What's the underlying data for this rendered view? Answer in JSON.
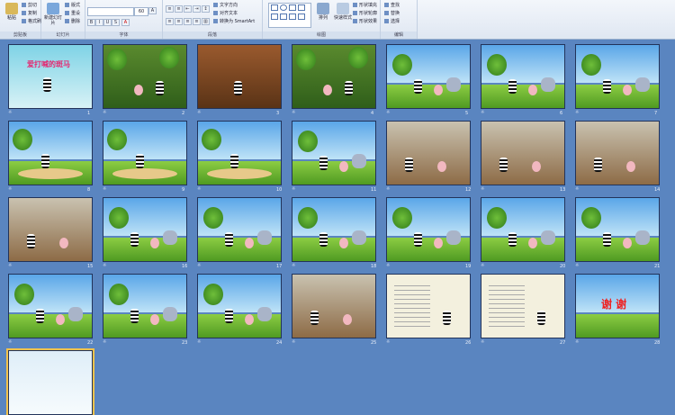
{
  "ribbon": {
    "groups": [
      {
        "label": "剪贴板"
      },
      {
        "label": "幻灯片"
      },
      {
        "label": "字体"
      },
      {
        "label": "段落"
      },
      {
        "label": "绘图"
      },
      {
        "label": "编辑"
      }
    ],
    "paste_label": "粘贴",
    "cut_label": "剪切",
    "copy_label": "复制",
    "format_painter_label": "格式刷",
    "new_slide_label": "新建幻灯片",
    "layout_label": "版式",
    "reset_label": "重设",
    "delete_label": "删除",
    "font_size": "60",
    "text_direction_label": "文字方向",
    "align_text_label": "对齐文本",
    "smartart_label": "转换为 SmartArt",
    "arrange_label": "排列",
    "quick_styles_label": "快速样式",
    "shape_fill_label": "形状填充",
    "shape_outline_label": "形状轮廓",
    "shape_effects_label": "形状效果",
    "find_label": "查找",
    "replace_label": "替换",
    "select_label": "选择"
  },
  "slides": [
    {
      "n": "1",
      "kind": "title",
      "text": "爱打喊的斑马"
    },
    {
      "n": "2",
      "kind": "forest"
    },
    {
      "n": "3",
      "kind": "room"
    },
    {
      "n": "4",
      "kind": "forest"
    },
    {
      "n": "5",
      "kind": "field"
    },
    {
      "n": "6",
      "kind": "field"
    },
    {
      "n": "7",
      "kind": "field"
    },
    {
      "n": "8",
      "kind": "beach"
    },
    {
      "n": "9",
      "kind": "beach"
    },
    {
      "n": "10",
      "kind": "beach"
    },
    {
      "n": "11",
      "kind": "field"
    },
    {
      "n": "12",
      "kind": "kitchen"
    },
    {
      "n": "13",
      "kind": "kitchen"
    },
    {
      "n": "14",
      "kind": "kitchen"
    },
    {
      "n": "15",
      "kind": "kitchen"
    },
    {
      "n": "16",
      "kind": "field"
    },
    {
      "n": "17",
      "kind": "field"
    },
    {
      "n": "18",
      "kind": "field"
    },
    {
      "n": "19",
      "kind": "field"
    },
    {
      "n": "20",
      "kind": "field"
    },
    {
      "n": "21",
      "kind": "field"
    },
    {
      "n": "22",
      "kind": "field"
    },
    {
      "n": "23",
      "kind": "field"
    },
    {
      "n": "24",
      "kind": "field"
    },
    {
      "n": "25",
      "kind": "kitchen"
    },
    {
      "n": "26",
      "kind": "paper"
    },
    {
      "n": "27",
      "kind": "paper"
    },
    {
      "n": "28",
      "kind": "thanks",
      "text": "谢 谢"
    },
    {
      "n": "",
      "kind": "last"
    }
  ]
}
